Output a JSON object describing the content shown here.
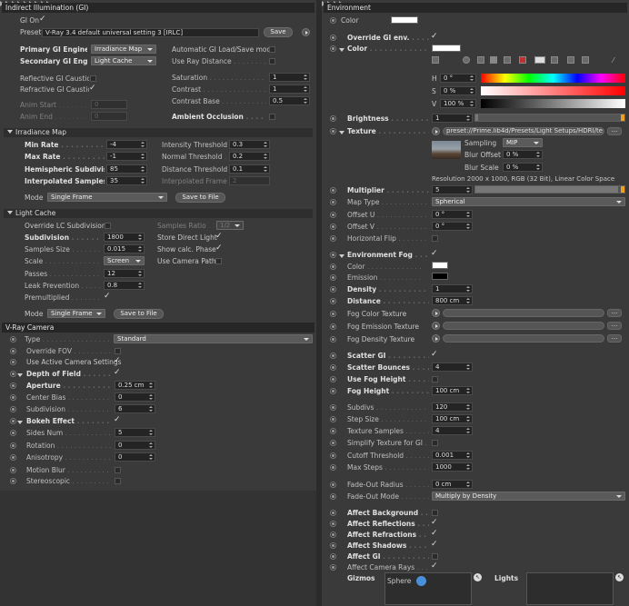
{
  "left": {
    "header": "Indirect Illumination (GI)",
    "gi_on": "GI On",
    "preset_label": "Preset",
    "preset_value": "V-Ray 3.4 default universal setting 3 [IRLC]",
    "save": "Save",
    "primary_engine": "Primary GI Engine",
    "primary_engine_value": "Irradiance Map",
    "secondary_engine": "Secondary GI Engine",
    "secondary_engine_value": "Light Cache",
    "auto_gi": "Automatic GI Load/Save mode",
    "use_ray": "Use Ray Distance",
    "refl_caustics": "Reflective GI Caustics",
    "refr_caustics": "Refractive GI Caustics",
    "saturation": "Saturation",
    "saturation_val": "1",
    "contrast": "Contrast",
    "contrast_val": "1",
    "contrast_base": "Contrast Base",
    "contrast_base_val": "0.5",
    "anim_start": "Anim Start",
    "anim_start_val": "0",
    "anim_end": "Anim End",
    "anim_end_val": "0",
    "ambient_occ": "Ambient Occlusion",
    "irr_header": "Irradiance Map",
    "min_rate": "Min Rate",
    "min_rate_val": "-4",
    "max_rate": "Max Rate",
    "max_rate_val": "-1",
    "hemi": "Hemispheric Subdivision",
    "hemi_val": "85",
    "interp": "Interpolated Samples",
    "interp_val": "35",
    "int_thr": "Intensity Threshold",
    "int_thr_val": "0.3",
    "norm_thr": "Normal Threshold",
    "norm_thr_val": "0.2",
    "dist_thr": "Distance Threshold",
    "dist_thr_val": "0.1",
    "interp_frames": "Interpolated Frames",
    "interp_frames_val": "2",
    "mode": "Mode",
    "irr_mode_val": "Single Frame",
    "save_to_file": "Save to File",
    "lc_header": "Light Cache",
    "override_lc": "Override LC Subdivision",
    "samples_ratio": "Samples Ratio",
    "samples_ratio_val": "1/2",
    "subdivision": "Subdivision",
    "subdivision_val": "1800",
    "samples_size": "Samples Size",
    "samples_size_val": "0.015",
    "scale": "Scale",
    "scale_val": "Screen",
    "passes": "Passes",
    "passes_val": "12",
    "leak": "Leak Prevention",
    "leak_val": "0.8",
    "premult": "Premultiplied",
    "store_direct": "Store Direct Light",
    "show_calc": "Show calc. Phase",
    "use_cam_path": "Use Camera Path",
    "lc_mode_val": "Single Frame",
    "cam_header": "V-Ray Camera",
    "type": "Type",
    "type_val": "Standard",
    "override_fov": "Override FOV",
    "use_active": "Use Active Camera Settings",
    "dof": "Depth of Field",
    "aperture": "Aperture",
    "aperture_val": "0.25 cm",
    "center_bias": "Center Bias",
    "center_bias_val": "0",
    "cam_subdiv": "Subdivision",
    "cam_subdiv_val": "6",
    "bokeh": "Bokeh Effect",
    "sides": "Sides Num",
    "sides_val": "5",
    "rotation": "Rotation",
    "rotation_val": "0",
    "aniso": "Anisotropy",
    "aniso_val": "0",
    "motion_blur": "Motion Blur",
    "stereo": "Stereoscopic"
  },
  "right": {
    "header": "Environment",
    "color": "Color",
    "override_gi": "Override GI env.",
    "color2": "Color",
    "h": "H",
    "h_val": "0 °",
    "s": "S",
    "s_val": "0 %",
    "v": "V",
    "v_val": "100 %",
    "brightness": "Brightness",
    "brightness_val": "1",
    "texture": "Texture",
    "texture_path": "preset://Prime.lib4d/Presets/Light Setups/HDRI/te",
    "sampling": "Sampling",
    "sampling_val": "MIP",
    "blur_offset": "Blur Offset",
    "blur_offset_val": "0 %",
    "blur_scale": "Blur Scale",
    "blur_scale_val": "0 %",
    "resolution": "Resolution 2000 x 1000, RGB (32 Bit), Linear Color Space",
    "multiplier": "Multiplier",
    "multiplier_val": "5",
    "map_type": "Map Type",
    "map_type_val": "Spherical",
    "offset_u": "Offset U",
    "offset_u_val": "0 °",
    "offset_v": "Offset V",
    "offset_v_val": "0 °",
    "hflip": "Horizontal Flip",
    "env_fog": "Environment Fog",
    "fog_color": "Color",
    "emission": "Emission",
    "density": "Density",
    "density_val": "1",
    "distance": "Distance",
    "distance_val": "800 cm",
    "fog_color_tex": "Fog Color Texture",
    "fog_emis_tex": "Fog Emission Texture",
    "fog_dens_tex": "Fog Density Texture",
    "scatter_gi": "Scatter GI",
    "scatter_bounces": "Scatter Bounces",
    "scatter_bounces_val": "4",
    "use_fog_height": "Use Fog Height",
    "fog_height": "Fog Height",
    "fog_height_val": "100 cm",
    "subdivs": "Subdivs",
    "subdivs_val": "120",
    "step_size": "Step Size",
    "step_size_val": "100 cm",
    "tex_samples": "Texture Samples",
    "tex_samples_val": "4",
    "simplify": "Simplify Texture for GI",
    "cutoff": "Cutoff Threshold",
    "cutoff_val": "0.001",
    "max_steps": "Max Steps",
    "max_steps_val": "1000",
    "fade_radius": "Fade-Out Radius",
    "fade_radius_val": "0 cm",
    "fade_mode": "Fade-Out Mode",
    "fade_mode_val": "Multiply by Density",
    "aff_bg": "Affect Background",
    "aff_refl": "Affect Reflections",
    "aff_refr": "Affect Refractions",
    "aff_shad": "Affect Shadows",
    "aff_gi": "Affect GI",
    "aff_cam": "Affect Camera Rays",
    "gizmos": "Gizmos",
    "sphere": "Sphere",
    "lights": "Lights",
    "ellipsis": "..."
  },
  "colors": {
    "accent": "#f0a020",
    "panel": "#3a3a3a",
    "white": "#ffffff"
  }
}
